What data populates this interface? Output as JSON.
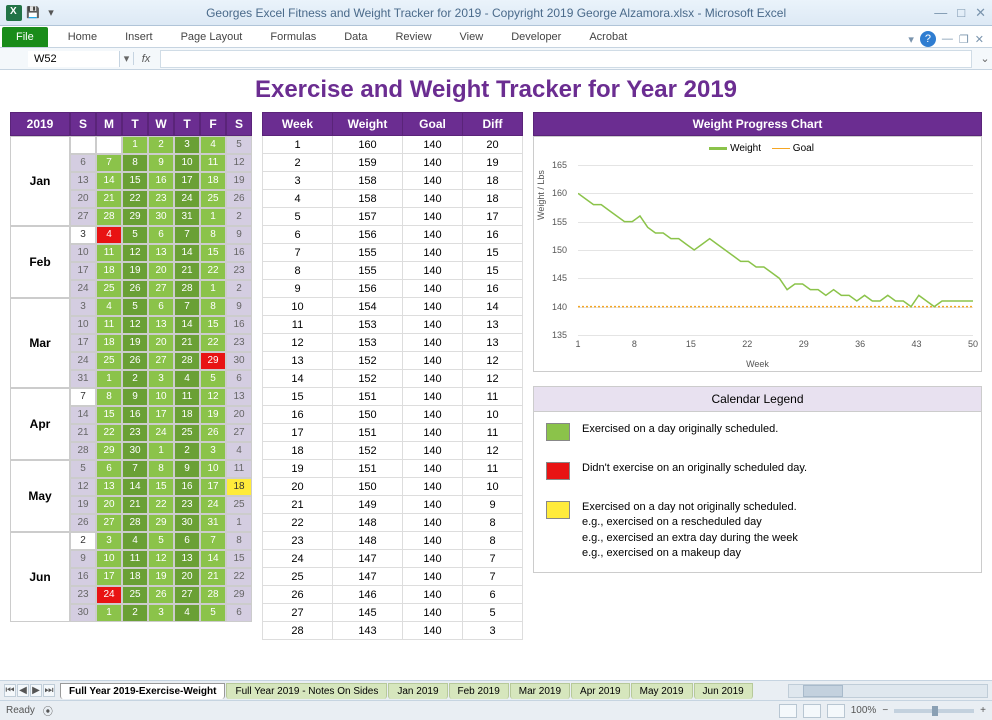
{
  "window": {
    "title": "Georges Excel Fitness and Weight Tracker for 2019 - Copyright 2019 George Alzamora.xlsx - Microsoft Excel"
  },
  "ribbon": {
    "file": "File",
    "tabs": [
      "Home",
      "Insert",
      "Page Layout",
      "Formulas",
      "Data",
      "Review",
      "View",
      "Developer",
      "Acrobat"
    ]
  },
  "namebox": "W52",
  "fx": "fx",
  "page_title": "Exercise and Weight Tracker for Year 2019",
  "calendar": {
    "year": "2019",
    "days": [
      "S",
      "M",
      "T",
      "W",
      "T",
      "F",
      "S"
    ],
    "months": [
      {
        "label": "Jan",
        "weeks": [
          [
            [
              "",
              ""
            ],
            [
              "",
              ""
            ],
            [
              "1",
              "green"
            ],
            [
              "2",
              "green"
            ],
            [
              "3",
              "dgreen"
            ],
            [
              "4",
              "green"
            ],
            [
              "5",
              "gray"
            ]
          ],
          [
            [
              "6",
              "gray"
            ],
            [
              "7",
              "green"
            ],
            [
              "8",
              "dgreen"
            ],
            [
              "9",
              "green"
            ],
            [
              "10",
              "dgreen"
            ],
            [
              "11",
              "green"
            ],
            [
              "12",
              "gray"
            ]
          ],
          [
            [
              "13",
              "gray"
            ],
            [
              "14",
              "green"
            ],
            [
              "15",
              "dgreen"
            ],
            [
              "16",
              "green"
            ],
            [
              "17",
              "dgreen"
            ],
            [
              "18",
              "green"
            ],
            [
              "19",
              "gray"
            ]
          ],
          [
            [
              "20",
              "gray"
            ],
            [
              "21",
              "green"
            ],
            [
              "22",
              "dgreen"
            ],
            [
              "23",
              "green"
            ],
            [
              "24",
              "dgreen"
            ],
            [
              "25",
              "green"
            ],
            [
              "26",
              "gray"
            ]
          ],
          [
            [
              "27",
              "gray"
            ],
            [
              "28",
              "green"
            ],
            [
              "29",
              "dgreen"
            ],
            [
              "30",
              "green"
            ],
            [
              "31",
              "dgreen"
            ],
            [
              "1",
              "green"
            ],
            [
              "2",
              "gray"
            ]
          ]
        ]
      },
      {
        "label": "Feb",
        "weeks": [
          [
            [
              "3",
              ""
            ],
            [
              "4",
              "red"
            ],
            [
              "5",
              "dgreen"
            ],
            [
              "6",
              "green"
            ],
            [
              "7",
              "dgreen"
            ],
            [
              "8",
              "green"
            ],
            [
              "9",
              "gray"
            ]
          ],
          [
            [
              "10",
              "gray"
            ],
            [
              "11",
              "green"
            ],
            [
              "12",
              "dgreen"
            ],
            [
              "13",
              "green"
            ],
            [
              "14",
              "dgreen"
            ],
            [
              "15",
              "green"
            ],
            [
              "16",
              "gray"
            ]
          ],
          [
            [
              "17",
              "gray"
            ],
            [
              "18",
              "green"
            ],
            [
              "19",
              "dgreen"
            ],
            [
              "20",
              "green"
            ],
            [
              "21",
              "dgreen"
            ],
            [
              "22",
              "green"
            ],
            [
              "23",
              "gray"
            ]
          ],
          [
            [
              "24",
              "gray"
            ],
            [
              "25",
              "green"
            ],
            [
              "26",
              "dgreen"
            ],
            [
              "27",
              "green"
            ],
            [
              "28",
              "dgreen"
            ],
            [
              "1",
              "green"
            ],
            [
              "2",
              "gray"
            ]
          ]
        ]
      },
      {
        "label": "Mar",
        "weeks": [
          [
            [
              "3",
              "gray"
            ],
            [
              "4",
              "green"
            ],
            [
              "5",
              "dgreen"
            ],
            [
              "6",
              "green"
            ],
            [
              "7",
              "dgreen"
            ],
            [
              "8",
              "green"
            ],
            [
              "9",
              "gray"
            ]
          ],
          [
            [
              "10",
              "gray"
            ],
            [
              "11",
              "green"
            ],
            [
              "12",
              "dgreen"
            ],
            [
              "13",
              "green"
            ],
            [
              "14",
              "dgreen"
            ],
            [
              "15",
              "green"
            ],
            [
              "16",
              "gray"
            ]
          ],
          [
            [
              "17",
              "gray"
            ],
            [
              "18",
              "green"
            ],
            [
              "19",
              "dgreen"
            ],
            [
              "20",
              "green"
            ],
            [
              "21",
              "dgreen"
            ],
            [
              "22",
              "green"
            ],
            [
              "23",
              "gray"
            ]
          ],
          [
            [
              "24",
              "gray"
            ],
            [
              "25",
              "green"
            ],
            [
              "26",
              "dgreen"
            ],
            [
              "27",
              "green"
            ],
            [
              "28",
              "dgreen"
            ],
            [
              "29",
              "red"
            ],
            [
              "30",
              "gray"
            ]
          ],
          [
            [
              "31",
              "gray"
            ],
            [
              "1",
              "green"
            ],
            [
              "2",
              "dgreen"
            ],
            [
              "3",
              "green"
            ],
            [
              "4",
              "dgreen"
            ],
            [
              "5",
              "green"
            ],
            [
              "6",
              "gray"
            ]
          ]
        ]
      },
      {
        "label": "Apr",
        "weeks": [
          [
            [
              "7",
              ""
            ],
            [
              "8",
              "green"
            ],
            [
              "9",
              "dgreen"
            ],
            [
              "10",
              "green"
            ],
            [
              "11",
              "dgreen"
            ],
            [
              "12",
              "green"
            ],
            [
              "13",
              "gray"
            ]
          ],
          [
            [
              "14",
              "gray"
            ],
            [
              "15",
              "green"
            ],
            [
              "16",
              "dgreen"
            ],
            [
              "17",
              "green"
            ],
            [
              "18",
              "dgreen"
            ],
            [
              "19",
              "green"
            ],
            [
              "20",
              "gray"
            ]
          ],
          [
            [
              "21",
              "gray"
            ],
            [
              "22",
              "green"
            ],
            [
              "23",
              "dgreen"
            ],
            [
              "24",
              "green"
            ],
            [
              "25",
              "dgreen"
            ],
            [
              "26",
              "green"
            ],
            [
              "27",
              "gray"
            ]
          ],
          [
            [
              "28",
              "gray"
            ],
            [
              "29",
              "green"
            ],
            [
              "30",
              "dgreen"
            ],
            [
              "1",
              "green"
            ],
            [
              "2",
              "dgreen"
            ],
            [
              "3",
              "green"
            ],
            [
              "4",
              "gray"
            ]
          ]
        ]
      },
      {
        "label": "May",
        "weeks": [
          [
            [
              "5",
              "gray"
            ],
            [
              "6",
              "green"
            ],
            [
              "7",
              "dgreen"
            ],
            [
              "8",
              "green"
            ],
            [
              "9",
              "dgreen"
            ],
            [
              "10",
              "green"
            ],
            [
              "11",
              "gray"
            ]
          ],
          [
            [
              "12",
              "gray"
            ],
            [
              "13",
              "green"
            ],
            [
              "14",
              "dgreen"
            ],
            [
              "15",
              "green"
            ],
            [
              "16",
              "dgreen"
            ],
            [
              "17",
              "green"
            ],
            [
              "18",
              "yellow"
            ]
          ],
          [
            [
              "19",
              "gray"
            ],
            [
              "20",
              "green"
            ],
            [
              "21",
              "dgreen"
            ],
            [
              "22",
              "green"
            ],
            [
              "23",
              "dgreen"
            ],
            [
              "24",
              "green"
            ],
            [
              "25",
              "gray"
            ]
          ],
          [
            [
              "26",
              "gray"
            ],
            [
              "27",
              "green"
            ],
            [
              "28",
              "dgreen"
            ],
            [
              "29",
              "green"
            ],
            [
              "30",
              "dgreen"
            ],
            [
              "31",
              "green"
            ],
            [
              "1",
              "gray"
            ]
          ]
        ]
      },
      {
        "label": "Jun",
        "weeks": [
          [
            [
              "2",
              ""
            ],
            [
              "3",
              "green"
            ],
            [
              "4",
              "dgreen"
            ],
            [
              "5",
              "green"
            ],
            [
              "6",
              "dgreen"
            ],
            [
              "7",
              "green"
            ],
            [
              "8",
              "gray"
            ]
          ],
          [
            [
              "9",
              "gray"
            ],
            [
              "10",
              "green"
            ],
            [
              "11",
              "dgreen"
            ],
            [
              "12",
              "green"
            ],
            [
              "13",
              "dgreen"
            ],
            [
              "14",
              "green"
            ],
            [
              "15",
              "gray"
            ]
          ],
          [
            [
              "16",
              "gray"
            ],
            [
              "17",
              "green"
            ],
            [
              "18",
              "dgreen"
            ],
            [
              "19",
              "green"
            ],
            [
              "20",
              "dgreen"
            ],
            [
              "21",
              "green"
            ],
            [
              "22",
              "gray"
            ]
          ],
          [
            [
              "23",
              "gray"
            ],
            [
              "24",
              "red"
            ],
            [
              "25",
              "dgreen"
            ],
            [
              "26",
              "green"
            ],
            [
              "27",
              "dgreen"
            ],
            [
              "28",
              "green"
            ],
            [
              "29",
              "gray"
            ]
          ],
          [
            [
              "30",
              "gray"
            ],
            [
              "1",
              "green"
            ],
            [
              "2",
              "dgreen"
            ],
            [
              "3",
              "green"
            ],
            [
              "4",
              "dgreen"
            ],
            [
              "5",
              "green"
            ],
            [
              "6",
              "gray"
            ]
          ]
        ]
      }
    ]
  },
  "weektable": {
    "headers": [
      "Week",
      "Weight",
      "Goal",
      "Diff"
    ],
    "rows": [
      [
        1,
        160,
        140,
        20
      ],
      [
        2,
        159,
        140,
        19
      ],
      [
        3,
        158,
        140,
        18
      ],
      [
        4,
        158,
        140,
        18
      ],
      [
        5,
        157,
        140,
        17
      ],
      [
        6,
        156,
        140,
        16
      ],
      [
        7,
        155,
        140,
        15
      ],
      [
        8,
        155,
        140,
        15
      ],
      [
        9,
        156,
        140,
        16
      ],
      [
        10,
        154,
        140,
        14
      ],
      [
        11,
        153,
        140,
        13
      ],
      [
        12,
        153,
        140,
        13
      ],
      [
        13,
        152,
        140,
        12
      ],
      [
        14,
        152,
        140,
        12
      ],
      [
        15,
        151,
        140,
        11
      ],
      [
        16,
        150,
        140,
        10
      ],
      [
        17,
        151,
        140,
        11
      ],
      [
        18,
        152,
        140,
        12
      ],
      [
        19,
        151,
        140,
        11
      ],
      [
        20,
        150,
        140,
        10
      ],
      [
        21,
        149,
        140,
        9
      ],
      [
        22,
        148,
        140,
        8
      ],
      [
        23,
        148,
        140,
        8
      ],
      [
        24,
        147,
        140,
        7
      ],
      [
        25,
        147,
        140,
        7
      ],
      [
        26,
        146,
        140,
        6
      ],
      [
        27,
        145,
        140,
        5
      ],
      [
        28,
        143,
        140,
        3
      ]
    ]
  },
  "chart": {
    "title": "Weight Progress Chart",
    "series1": "Weight",
    "series2": "Goal",
    "ylabel": "Weight / Lbs",
    "xlabel": "Week"
  },
  "chart_data": {
    "type": "line",
    "x": [
      1,
      8,
      15,
      22,
      29,
      36,
      43,
      50
    ],
    "ylim": [
      135,
      165
    ],
    "yticks": [
      135,
      140,
      145,
      150,
      155,
      160,
      165
    ],
    "series": [
      {
        "name": "Weight",
        "values": [
          160,
          159,
          158,
          158,
          157,
          156,
          155,
          155,
          156,
          154,
          153,
          153,
          152,
          152,
          151,
          150,
          151,
          152,
          151,
          150,
          149,
          148,
          148,
          147,
          147,
          146,
          145,
          143,
          144,
          144,
          143,
          143,
          142,
          143,
          142,
          142,
          141,
          142,
          141,
          141,
          142,
          141,
          141,
          140,
          142,
          141,
          140,
          141,
          141,
          141,
          141,
          141
        ]
      },
      {
        "name": "Goal",
        "values": [
          140,
          140,
          140,
          140,
          140,
          140,
          140,
          140,
          140,
          140,
          140,
          140,
          140,
          140,
          140,
          140,
          140,
          140,
          140,
          140,
          140,
          140,
          140,
          140,
          140,
          140,
          140,
          140,
          140,
          140,
          140,
          140,
          140,
          140,
          140,
          140,
          140,
          140,
          140,
          140,
          140,
          140,
          140,
          140,
          140,
          140,
          140,
          140,
          140,
          140,
          140,
          140
        ]
      }
    ]
  },
  "legend": {
    "title": "Calendar Legend",
    "green": "Exercised on a day originally scheduled.",
    "red": "Didn't exercise on an originally scheduled day.",
    "yellow": "Exercised on a day not originally scheduled.",
    "yellow_eg1": "e.g., exercised on a rescheduled day",
    "yellow_eg2": "e.g., exercised an extra day during the week",
    "yellow_eg3": "e.g., exercised on a makeup day"
  },
  "sheets": [
    "Full Year 2019-Exercise-Weight",
    "Full Year 2019 - Notes On Sides",
    "Jan 2019",
    "Feb 2019",
    "Mar 2019",
    "Apr 2019",
    "May 2019",
    "Jun 2019"
  ],
  "status": {
    "ready": "Ready",
    "zoom": "100%"
  }
}
